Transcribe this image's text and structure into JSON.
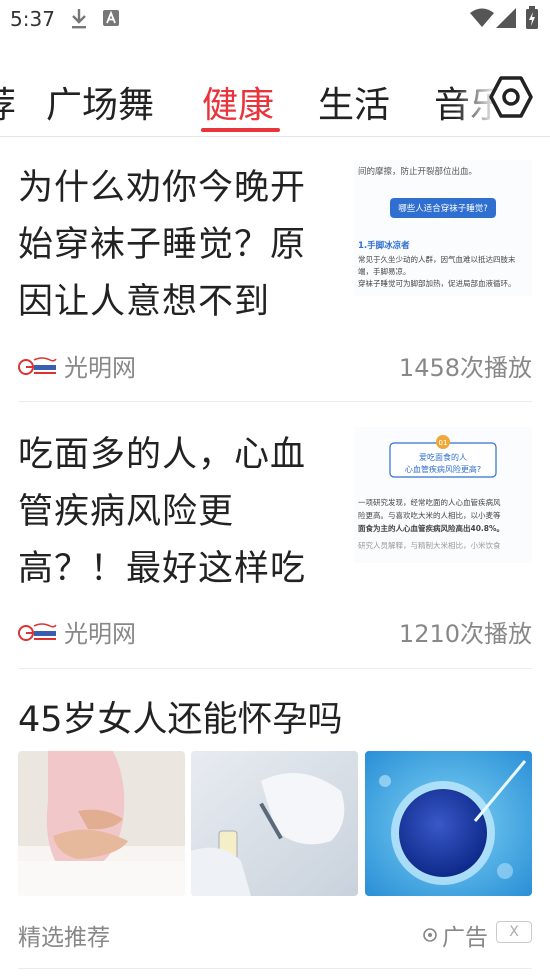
{
  "status_bar": {
    "time": "5:37"
  },
  "tabs": [
    {
      "label": "荐"
    },
    {
      "label": "广场舞"
    },
    {
      "label": "健康"
    },
    {
      "label": "生活"
    },
    {
      "label": "音乐"
    }
  ],
  "feed": [
    {
      "title": "为什么劝你今晚开始穿袜子睡觉？原因让人意想不到",
      "source": "光明网",
      "plays": "1458次播放",
      "thumb": {
        "line1": "间的摩擦，防止开裂部位出血。",
        "pill": "哪些人适合穿袜子睡觉?",
        "heading": "1.手脚冰凉者",
        "body1": "常见于久坐少动的人群，因气血难以抵达四肢末",
        "body2": "端，手脚易凉。",
        "body3": "穿袜子睡觉可为脚部加热，促进局部血液循环。"
      }
    },
    {
      "title": "吃面多的人，心血管疾病风险更高？！最好这样吃",
      "source": "光明网",
      "plays": "1210次播放",
      "thumb": {
        "badge": "01",
        "box1": "爱吃面食的人",
        "box2": "心血管疾病风险更高?",
        "body1": "一项研究发现，经常吃面的人心血管疾病风",
        "body2": "险更高。与喜欢吃大米的人相比，以小麦等",
        "body3": "面食为主的人心血管疾病风险高出40.8%。",
        "body4": "研究人员解释，与精制大米相比，小米饮食"
      }
    }
  ],
  "ad": {
    "title": "45岁女人还能怀孕吗",
    "recommend": "精选推荐",
    "ad_label": "广告",
    "close": "X"
  }
}
